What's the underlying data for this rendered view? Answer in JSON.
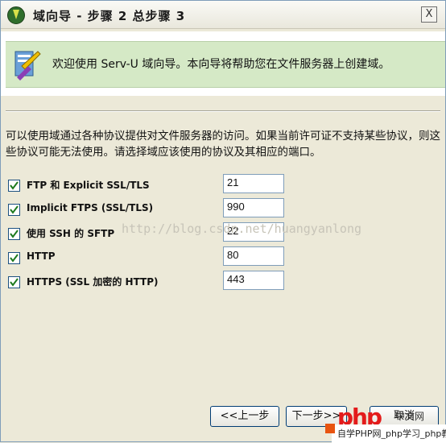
{
  "window": {
    "title": "域向导 - 步骤 2 总步骤 3",
    "close_label": "X"
  },
  "banner": {
    "text": "欢迎使用 Serv-U 域向导。本向导将帮助您在文件服务器上创建域。"
  },
  "description": "可以使用域通过各种协议提供对文件服务器的访问。如果当前许可证不支持某些协议，则这些协议可能无法使用。请选择域应该使用的协议及其相应的端口。",
  "protocols": [
    {
      "label": "FTP 和 Explicit SSL/TLS",
      "port": "21",
      "checked": true
    },
    {
      "label": "Implicit FTPS (SSL/TLS)",
      "port": "990",
      "checked": true
    },
    {
      "label": "使用 SSH 的 SFTP",
      "port": "22",
      "checked": true
    },
    {
      "label": "HTTP",
      "port": "80",
      "checked": true
    },
    {
      "label": "HTTPS (SSL 加密的 HTTP)",
      "port": "443",
      "checked": true
    }
  ],
  "watermark": "http://blog.csdn.net/huangyanlong",
  "buttons": {
    "back": "<<上一步",
    "next": "下一步>>",
    "cancel": "取消"
  },
  "footer": {
    "logo_text": "php",
    "brand": "中文网",
    "site_text": "自学PHP网_php学习_php教"
  },
  "colors": {
    "banner_bg": "#d5e9c6",
    "window_bg": "#ece9d8",
    "accent": "#003c74"
  }
}
